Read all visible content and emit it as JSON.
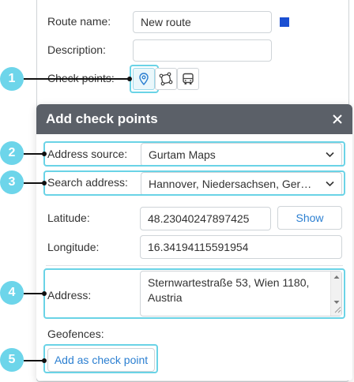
{
  "route": {
    "name_label": "Route name:",
    "name_value": "New route",
    "description_label": "Description:",
    "description_value": "",
    "checkpoints_label": "Check points:",
    "route_color": "#1b4fd2",
    "checkpoint_buttons": [
      {
        "icon": "map-pin-icon"
      },
      {
        "icon": "route-polygon-icon"
      },
      {
        "icon": "bus-icon"
      }
    ]
  },
  "dialog": {
    "title": "Add check points",
    "address_source_label": "Address source:",
    "address_source_value": "Gurtam Maps",
    "search_address_label": "Search address:",
    "search_address_value": "Hannover, Niedersachsen, Germany",
    "latitude_label": "Latitude:",
    "latitude_value": "48.23040247897425",
    "show_button": "Show",
    "longitude_label": "Longitude:",
    "longitude_value": "16.34194115591954",
    "address_label": "Address:",
    "address_value": "Sternwartestraße 53, Wien 1180, Austria",
    "geofences_label": "Geofences:",
    "add_button": "Add as check point"
  },
  "callouts": [
    "1",
    "2",
    "3",
    "4",
    "5"
  ],
  "colors": {
    "accent": "#6dd5ea",
    "header": "#5b6068",
    "link": "#2b7fd1"
  }
}
